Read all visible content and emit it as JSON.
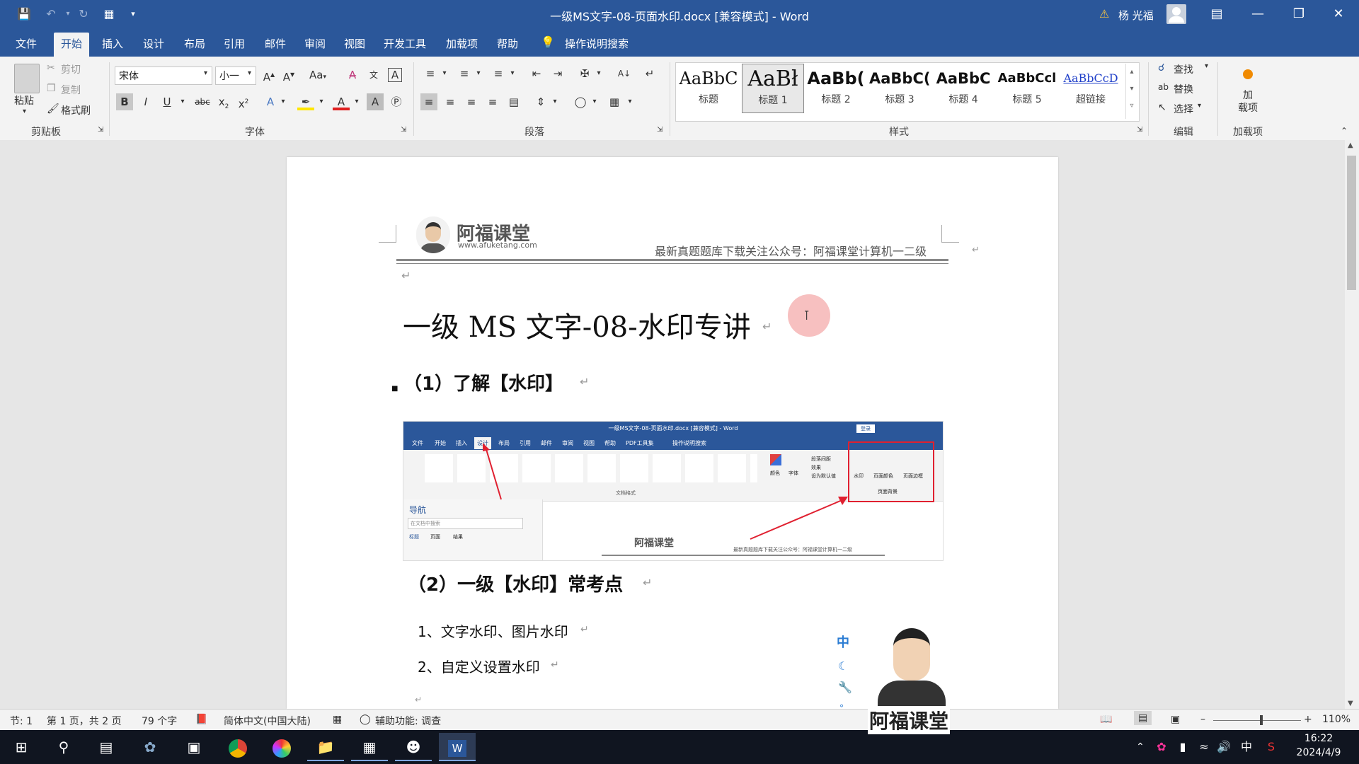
{
  "window": {
    "title": "一级MS文字-08-页面水印.docx [兼容模式] - Word",
    "user": "杨 光福",
    "accent": "#2b579a"
  },
  "menu": {
    "tabs": [
      "文件",
      "开始",
      "插入",
      "设计",
      "布局",
      "引用",
      "邮件",
      "审阅",
      "视图",
      "开发工具",
      "加载项",
      "帮助"
    ],
    "search_label": "操作说明搜索"
  },
  "ribbon": {
    "clipboard": {
      "paste": "粘贴",
      "cut": "剪切",
      "copy": "复制",
      "format_painter": "格式刷",
      "label": "剪贴板"
    },
    "font": {
      "name": "宋体",
      "size": "小一",
      "label": "字体",
      "change_case": "Aa"
    },
    "paragraph": {
      "label": "段落"
    },
    "styles": {
      "label": "样式",
      "items": [
        {
          "preview": "AaBbC",
          "name": "标题"
        },
        {
          "preview": "AaBł",
          "name": "标题 1"
        },
        {
          "preview": "AaBb(",
          "name": "标题 2"
        },
        {
          "preview": "AaBbC(",
          "name": "标题 3"
        },
        {
          "preview": "AaBbC",
          "name": "标题 4"
        },
        {
          "preview": "AaBbCcl",
          "name": "标题 5"
        },
        {
          "preview": "AaBbCcD",
          "name": "超链接"
        }
      ]
    },
    "editing": {
      "find": "查找",
      "replace": "替换",
      "select": "选择",
      "label": "编辑"
    },
    "addins": {
      "button": "加\n载项",
      "label": "加载项"
    }
  },
  "document": {
    "header_logo_name": "阿福课堂",
    "header_logo_url": "www.afuketang.com",
    "header_text": "最新真题题库下载关注公众号：阿福课堂计算机一二级",
    "title": "一级 MS 文字-08-水印专讲",
    "section1": "（1）了解【水印】",
    "section2": "（2）一级【水印】常考点",
    "item1": "1、文字水印、图片水印",
    "item2": "2、自定义设置水印",
    "mini": {
      "title": "一级MS文字-08-页面水印.docx [兼容模式] - Word",
      "tabs": [
        "文件",
        "开始",
        "插入",
        "设计",
        "布局",
        "引用",
        "邮件",
        "审阅",
        "视图",
        "帮助",
        "PDF工具集"
      ],
      "search": "操作说明搜索",
      "login": "登录",
      "nav_title": "导航",
      "nav_search": "在文档中搜索",
      "nav_tabs": [
        "标题",
        "页面",
        "结果"
      ],
      "doc_format": "文档格式",
      "page_bg": "页面背景",
      "bg_items": [
        "水印",
        "页面颜色",
        "页面边框"
      ],
      "opts": [
        "段落间距",
        "效果",
        "设为默认值"
      ],
      "colors": "颜色",
      "fonts": "字体",
      "header_name": "阿福课堂",
      "header_text": "最新真题题库下载关注公众号：阿福课堂计算机一二级"
    },
    "watermark_logo": "阿福课堂",
    "side_icons": [
      "中"
    ]
  },
  "statusbar": {
    "section": "节: 1",
    "page": "第 1 页，共 2 页",
    "words": "79 个字",
    "language": "简体中文(中国大陆)",
    "accessibility": "辅助功能: 调查",
    "zoom": "110%",
    "zoom_level": 0.55
  },
  "taskbar": {
    "ime": "中",
    "time": "16:22",
    "date": "2024/4/9"
  }
}
